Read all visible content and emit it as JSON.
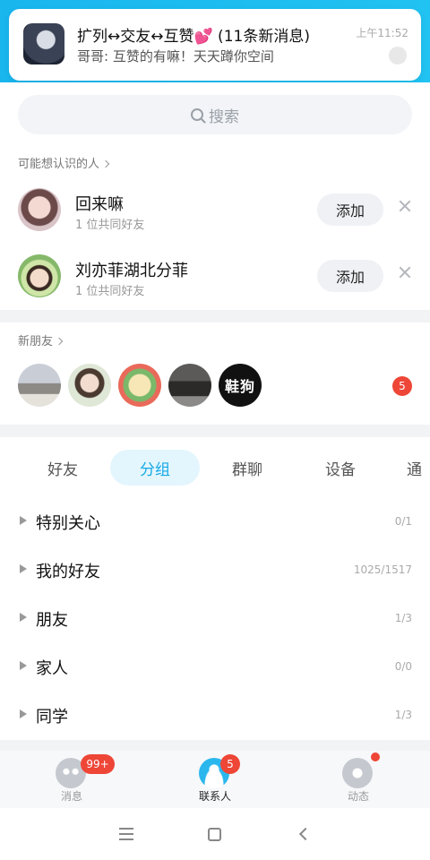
{
  "notification": {
    "title": "扩列↔交友↔互赞💕 (11条新消息)",
    "message": "哥哥: 互赞的有嘛！天天蹲你空间",
    "time": "上午11:52"
  },
  "search": {
    "placeholder": "搜索"
  },
  "may_know": {
    "title": "可能想认识的人",
    "people": [
      {
        "name": "回来嘛",
        "mutual": "1 位共同好友",
        "add_label": "添加"
      },
      {
        "name": "刘亦菲湖北分菲",
        "mutual": "1 位共同好友",
        "add_label": "添加"
      }
    ]
  },
  "new_friends": {
    "title": "新朋友",
    "last_avatar_text": "鞋狗",
    "badge": "5"
  },
  "tabs": {
    "items": [
      "好友",
      "分组",
      "群聊",
      "设备",
      "通"
    ],
    "active": "分组"
  },
  "groups": [
    {
      "name": "特别关心",
      "count": "0/1"
    },
    {
      "name": "我的好友",
      "count": "1025/1517"
    },
    {
      "name": "朋友",
      "count": "1/3"
    },
    {
      "name": "家人",
      "count": "0/0"
    },
    {
      "name": "同学",
      "count": "1/3"
    }
  ],
  "tabbar": {
    "messages": {
      "label": "消息",
      "badge": "99+"
    },
    "contacts": {
      "label": "联系人",
      "badge": "5"
    },
    "feed": {
      "label": "动态"
    }
  },
  "colors": {
    "accent": "#15a8e6",
    "header": "#1cbcf0",
    "badge_red": "#ee4637"
  },
  "icons": [
    "search-icon",
    "chevron-right-icon",
    "close-icon",
    "triangle-right-icon",
    "chat-icon",
    "contacts-icon",
    "planet-icon",
    "menu-icon",
    "home-icon",
    "back-icon"
  ]
}
